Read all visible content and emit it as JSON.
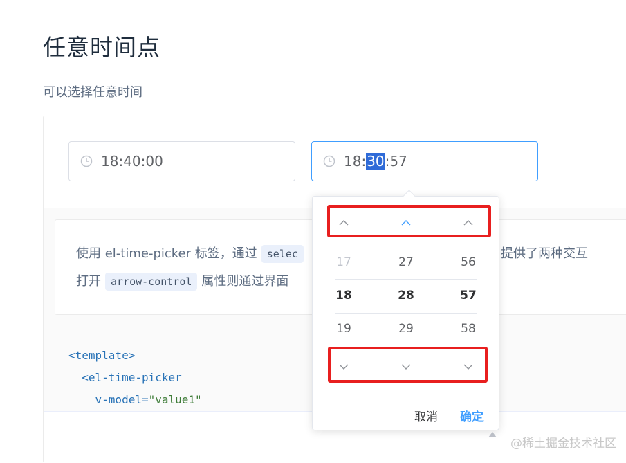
{
  "heading": "任意时间点",
  "description": "可以选择任意时间",
  "picker1": {
    "value": "18:40:00",
    "icon": "clock-icon"
  },
  "picker2": {
    "value_prefix": "18:",
    "value_selected": "30",
    "value_suffix": ":57",
    "icon": "clock-icon"
  },
  "dropdown": {
    "hours": [
      "17",
      "18",
      "19"
    ],
    "minutes": [
      "27",
      "28",
      "29"
    ],
    "seconds": [
      "56",
      "57",
      "58"
    ],
    "cancel_label": "取消",
    "confirm_label": "确定"
  },
  "meta": {
    "line1_prefix": "使用 el-time-picker 标签，通过",
    "line1_code": "selec",
    "line1_suffix": "围。提供了两种交互",
    "line2_prefix": "打开",
    "line2_code": "arrow-control",
    "line2_suffix": "属性则通过界面"
  },
  "code_lines": {
    "line1": "<template>",
    "line2": "  <el-time-picker",
    "line3_attr": "    v-model=",
    "line3_value": "\"value1\""
  },
  "watermark": "@稀土掘金技术社区",
  "colors": {
    "accent": "#409eff",
    "highlight_box": "#e81f1f",
    "selection": "#2f6bd8"
  }
}
